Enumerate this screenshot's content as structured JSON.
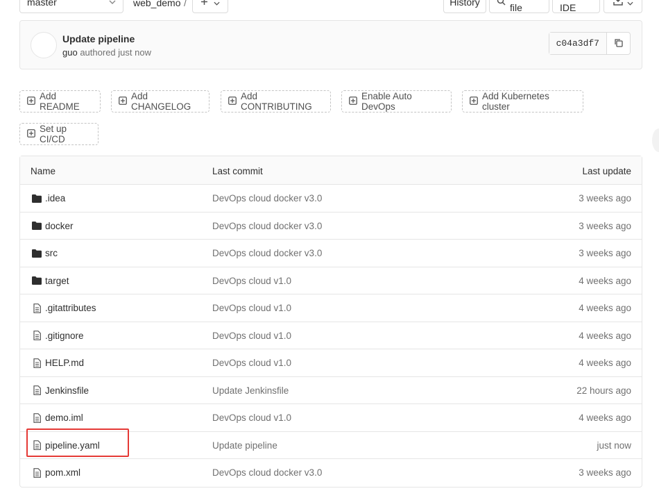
{
  "toolbar": {
    "branch": "master",
    "path": "web_demo",
    "separator": "/",
    "add_label": "+",
    "history": "History",
    "find_file": "Find file",
    "web_ide": "Web IDE"
  },
  "last_commit": {
    "title": "Update pipeline",
    "author": "guo",
    "meta": "authored just now",
    "sha": "c04a3df7"
  },
  "quick_actions": [
    "Add README",
    "Add CHANGELOG",
    "Add CONTRIBUTING",
    "Enable Auto DevOps",
    "Add Kubernetes cluster",
    "Set up CI/CD"
  ],
  "table": {
    "headers": {
      "name": "Name",
      "last_commit": "Last commit",
      "last_update": "Last update"
    },
    "rows": [
      {
        "name": ".idea",
        "type": "folder",
        "commit": "DevOps cloud docker v3.0",
        "updated": "3 weeks ago"
      },
      {
        "name": "docker",
        "type": "folder",
        "commit": "DevOps cloud docker v3.0",
        "updated": "3 weeks ago"
      },
      {
        "name": "src",
        "type": "folder",
        "commit": "DevOps cloud docker v3.0",
        "updated": "3 weeks ago"
      },
      {
        "name": "target",
        "type": "folder",
        "commit": "DevOps cloud v1.0",
        "updated": "4 weeks ago"
      },
      {
        "name": ".gitattributes",
        "type": "file",
        "commit": "DevOps cloud v1.0",
        "updated": "4 weeks ago"
      },
      {
        "name": ".gitignore",
        "type": "file",
        "commit": "DevOps cloud v1.0",
        "updated": "4 weeks ago"
      },
      {
        "name": "HELP.md",
        "type": "file",
        "commit": "DevOps cloud v1.0",
        "updated": "4 weeks ago"
      },
      {
        "name": "Jenkinsfile",
        "type": "file",
        "commit": "Update Jenkinsfile",
        "updated": "22 hours ago"
      },
      {
        "name": "demo.iml",
        "type": "file",
        "commit": "DevOps cloud v1.0",
        "updated": "4 weeks ago"
      },
      {
        "name": "pipeline.yaml",
        "type": "file",
        "commit": "Update pipeline",
        "updated": "just now"
      },
      {
        "name": "pom.xml",
        "type": "file",
        "commit": "DevOps cloud docker v3.0",
        "updated": "3 weeks ago"
      }
    ]
  },
  "colors": {
    "highlight": "#e53935",
    "border": "#e5e5e5",
    "muted_text": "#707070"
  }
}
